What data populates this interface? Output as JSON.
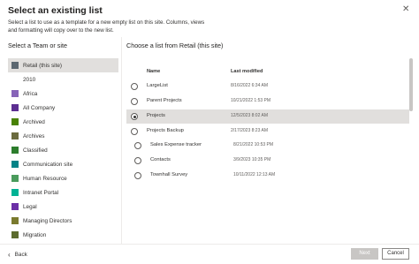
{
  "dialog": {
    "title": "Select an existing list",
    "description": "Select a list to use as a template for a new empty list on this site. Columns, views and formatting will copy over to the new list.",
    "close_icon": "close-icon"
  },
  "left": {
    "heading": "Select a Team or site",
    "sites": [
      {
        "label": "Retail (this site)",
        "color": "#5b6770",
        "selected": true
      },
      {
        "label": "2010",
        "color": "",
        "selected": false
      },
      {
        "label": "Africa",
        "color": "#8764b8",
        "selected": false
      },
      {
        "label": "All Company",
        "color": "#5c2e91",
        "selected": false
      },
      {
        "label": "Archived",
        "color": "#498205",
        "selected": false
      },
      {
        "label": "Archives",
        "color": "#6b6b3f",
        "selected": false
      },
      {
        "label": "Classified",
        "color": "#2d7d2d",
        "selected": false
      },
      {
        "label": "Communication site",
        "color": "#038387",
        "selected": false
      },
      {
        "label": "Human Resource",
        "color": "#4a9b5c",
        "selected": false
      },
      {
        "label": "Intranet Portal",
        "color": "#00b294",
        "selected": false
      },
      {
        "label": "Legal",
        "color": "#6b2fa6",
        "selected": false
      },
      {
        "label": "Managing Directors",
        "color": "#7a7a2e",
        "selected": false
      },
      {
        "label": "Migration",
        "color": "#5c6b2e",
        "selected": false
      }
    ]
  },
  "right": {
    "heading": "Choose a list from Retail (this site)",
    "columns": {
      "name": "Name",
      "modified": "Last modified"
    },
    "lists": [
      {
        "name": "LargeList",
        "modified": "8/16/2022 6:34 AM",
        "selected": false,
        "indent": false
      },
      {
        "name": "Parent Projects",
        "modified": "10/21/2022 1:53 PM",
        "selected": false,
        "indent": false
      },
      {
        "name": "Projects",
        "modified": "12/5/2023 8:02 AM",
        "selected": true,
        "indent": false
      },
      {
        "name": "Projects Backup",
        "modified": "2/17/2023 8:23 AM",
        "selected": false,
        "indent": false
      },
      {
        "name": "Sales Expense tracker",
        "modified": "8/21/2022 10:53 PM",
        "selected": false,
        "indent": true
      },
      {
        "name": "Contacts",
        "modified": "3/9/2023 10:35 PM",
        "selected": false,
        "indent": true
      },
      {
        "name": "Townhall Survey",
        "modified": "10/11/2022 12:13 AM",
        "selected": false,
        "indent": true
      }
    ]
  },
  "footer": {
    "back_label": "Back",
    "back_icon": "arrow-left-icon",
    "next_label": "Next",
    "cancel_label": "Cancel"
  }
}
